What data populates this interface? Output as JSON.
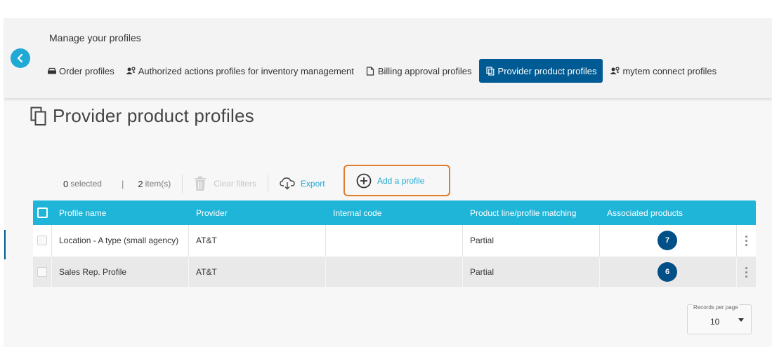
{
  "header": {
    "title": "Manage your profiles",
    "back_icon": "chevron-left-icon",
    "accent": "#1fa9d4",
    "active_tab_color": "#005b94",
    "tabs": [
      {
        "label": "Order profiles",
        "icon": "order-icon",
        "active": false
      },
      {
        "label": "Authorized actions profiles for inventory management",
        "icon": "users-key-icon",
        "active": false
      },
      {
        "label": "Billing approval profiles",
        "icon": "document-icon",
        "active": false
      },
      {
        "label": "Provider product profiles",
        "icon": "copy-icon",
        "active": true
      },
      {
        "label": "mytem connect profiles",
        "icon": "users-key-icon",
        "active": false
      }
    ]
  },
  "page": {
    "title": "Provider product profiles",
    "title_icon": "copy-icon"
  },
  "toolbar": {
    "selected_count": "0",
    "selected_label": "selected",
    "separator": "|",
    "items_count": "2",
    "items_label": "item(s)",
    "clear_filters": "Clear filters",
    "export": "Export",
    "add_profile": "Add a profile",
    "highlight_color": "#e07c2a"
  },
  "table": {
    "header_color": "#1fb5d9",
    "columns": [
      "Profile name",
      "Provider",
      "Internal code",
      "Product line/profile matching",
      "Associated products"
    ],
    "rows": [
      {
        "name": "Location - A type (small agency)",
        "provider": "AT&T",
        "internal_code": "",
        "matching": "Partial",
        "associated": "7"
      },
      {
        "name": "Sales Rep. Profile",
        "provider": "AT&T",
        "internal_code": "",
        "matching": "Partial",
        "associated": "6"
      }
    ]
  },
  "pagination": {
    "records_label": "Records per page",
    "records_value": "10"
  }
}
